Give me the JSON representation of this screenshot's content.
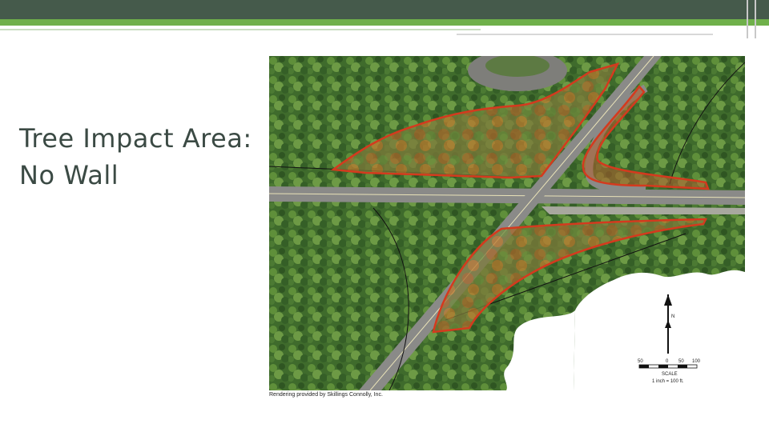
{
  "slide": {
    "title_line1": "Tree Impact Area:",
    "title_line2": "No Wall"
  },
  "figure": {
    "caption": "Rendering provided by Skillings Connolly, Inc.",
    "north_arrow_label": "N",
    "scale_bar_ticks": [
      "50",
      "0",
      "50",
      "100"
    ],
    "scale_label": "SCALE",
    "scale_ratio": "1 inch = 100 ft."
  },
  "colors": {
    "header_dark": "#455a4b",
    "header_accent": "#6fb04a",
    "impact_area": "#d43a1e",
    "title_text": "#3b4a44"
  }
}
